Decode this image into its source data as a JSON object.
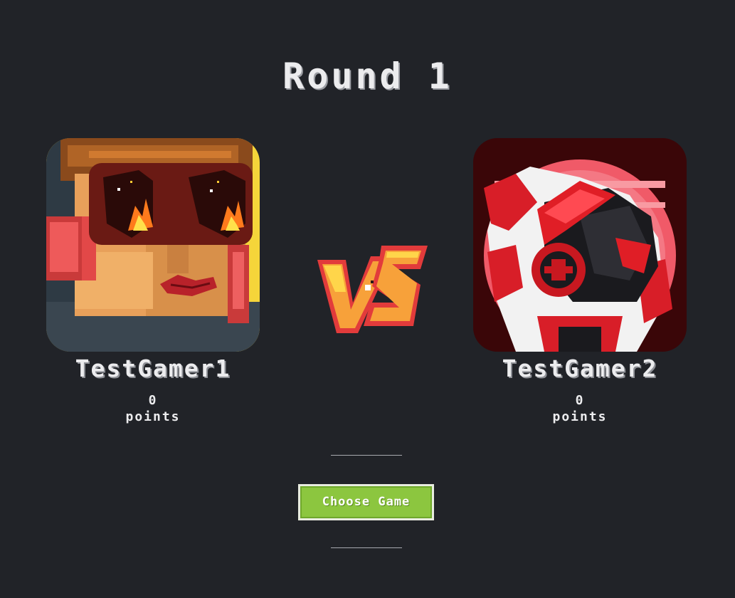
{
  "round": {
    "title": "Round 1"
  },
  "players": [
    {
      "name": "TestGamer1",
      "score": "0",
      "score_unit": "points",
      "avatar_icon": "pixel-goggles-woman-avatar"
    },
    {
      "name": "TestGamer2",
      "score": "0",
      "score_unit": "points",
      "avatar_icon": "pixel-red-headphones-wolf-avatar"
    }
  ],
  "vs": {
    "icon": "vs-emblem",
    "colors": {
      "fill": "#f7a13a",
      "highlight": "#ffd54a",
      "outline": "#e23b3b"
    }
  },
  "actions": {
    "choose_game_label": "Choose Game"
  },
  "theme": {
    "background": "#212328",
    "button": "#8cc63f",
    "text": "#ececee"
  }
}
